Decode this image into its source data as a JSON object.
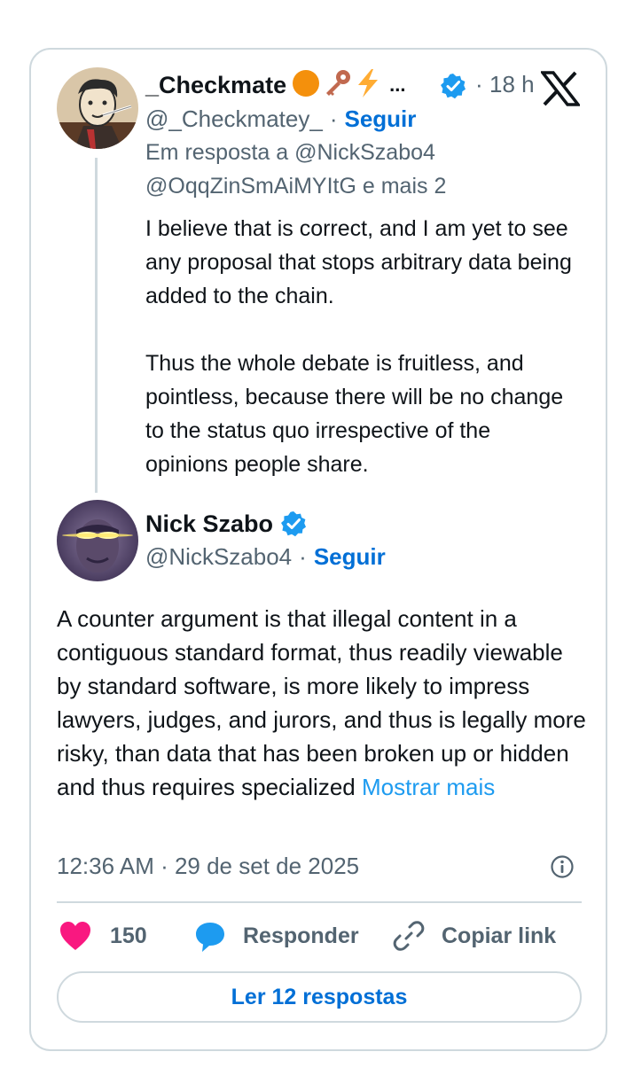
{
  "reply_tweet": {
    "display_name": "_Checkmate",
    "name_emojis": [
      "orange-circle-icon",
      "key-icon",
      "lightning-icon"
    ],
    "ellipsis": "...",
    "handle": "@_Checkmatey_",
    "separator": "·",
    "follow_label": "Seguir",
    "time": "18 h",
    "reply_context_line1": "Em resposta a @NickSzabo4",
    "reply_context_line2": "@OqqZinSmAiMYItG e mais 2",
    "paragraph1": "I believe that is correct, and I am yet to see any proposal that stops arbitrary data being added to the chain.",
    "paragraph2": "Thus the whole debate is fruitless, and pointless, because there will be no change to the status quo irrespective of the opinions people share."
  },
  "main_tweet": {
    "display_name": "Nick Szabo",
    "handle": "@NickSzabo4",
    "separator": "·",
    "follow_label": "Seguir",
    "text": "A counter argument is that illegal content in a contiguous standard format, thus readily viewable by standard software, is more likely to impress lawyers, judges, and jurors, and thus is legally more risky, than data that has been broken up or hidden and thus requires specialized",
    "show_more": "Mostrar mais",
    "timestamp": "12:36 AM · 29 de set de 2025"
  },
  "actions": {
    "likes": "150",
    "reply_label": "Responder",
    "copy_link_label": "Copiar link"
  },
  "read_replies_label": "Ler 12 respostas",
  "colors": {
    "accent": "#1d9bf0",
    "link": "#006fd6",
    "heart": "#f91880",
    "verified": "#1d9bf0",
    "border": "#cfd9de",
    "muted": "#536471"
  }
}
